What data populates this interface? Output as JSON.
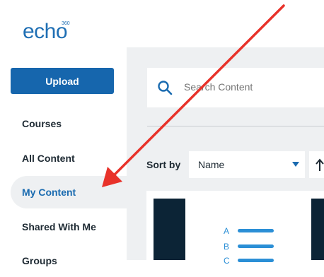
{
  "logo": {
    "text": "echo",
    "sup": "360"
  },
  "sidebar": {
    "upload_label": "Upload",
    "items": [
      {
        "label": "Courses"
      },
      {
        "label": "All Content"
      },
      {
        "label": "My Content",
        "active": true
      },
      {
        "label": "Shared With Me"
      },
      {
        "label": "Groups"
      }
    ]
  },
  "search": {
    "placeholder": "Search Content"
  },
  "sort": {
    "label": "Sort by",
    "value": "Name"
  },
  "thumbnail": {
    "letters": [
      "A",
      "B",
      "C"
    ]
  },
  "colors": {
    "brand": "#1f6fb4",
    "upload_bg": "#1666ad",
    "active_text": "#1a6bb0",
    "panel_bg": "#eef0f2",
    "thumb_dark": "#0c2436",
    "annotation_arrow": "#e8322a"
  }
}
